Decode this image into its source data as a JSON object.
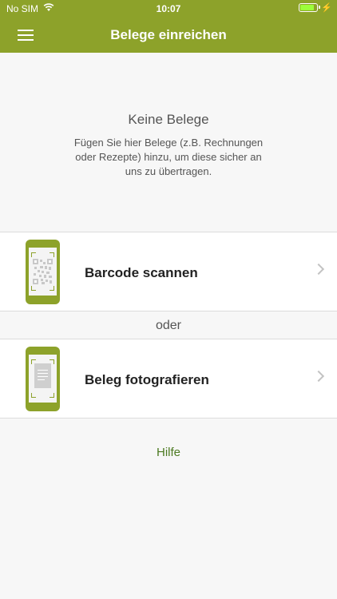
{
  "status_bar": {
    "carrier": "No SIM",
    "time": "10:07"
  },
  "nav": {
    "title": "Belege einreichen"
  },
  "empty_state": {
    "title": "Keine Belege",
    "text": "Fügen Sie hier Belege (z.B. Rechnungen oder Rezepte) hinzu, um diese sicher an uns zu übertragen."
  },
  "options": [
    {
      "label": "Barcode scannen",
      "icon": "qr-phone-icon"
    },
    {
      "label": "Beleg fotografieren",
      "icon": "document-phone-icon"
    }
  ],
  "separator": "oder",
  "help_label": "Hilfe",
  "colors": {
    "brand": "#8da22a",
    "link": "#4c7a21",
    "background": "#f7f7f7"
  }
}
